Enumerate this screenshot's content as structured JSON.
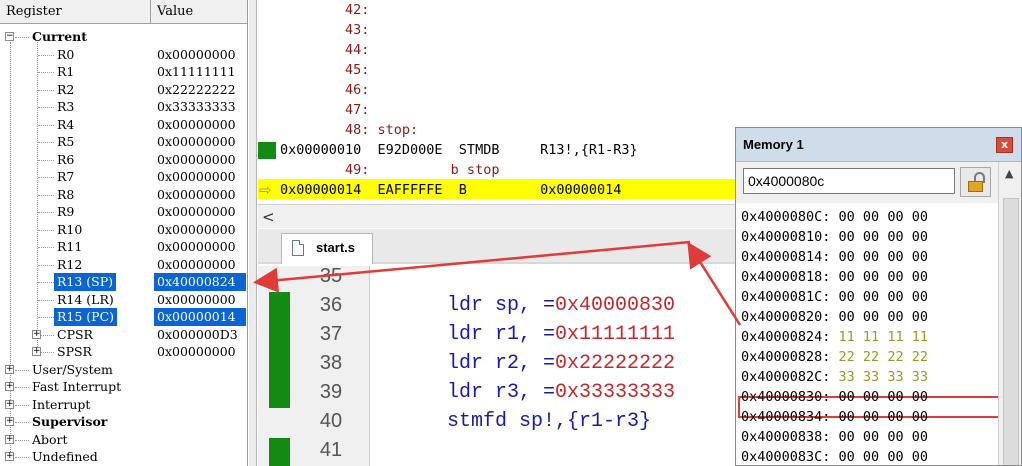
{
  "registers": {
    "header": {
      "register": "Register",
      "value": "Value"
    },
    "current_group": "Current",
    "rows": [
      {
        "name": "R0",
        "value": "0x00000000"
      },
      {
        "name": "R1",
        "value": "0x11111111"
      },
      {
        "name": "R2",
        "value": "0x22222222"
      },
      {
        "name": "R3",
        "value": "0x33333333"
      },
      {
        "name": "R4",
        "value": "0x00000000"
      },
      {
        "name": "R5",
        "value": "0x00000000"
      },
      {
        "name": "R6",
        "value": "0x00000000"
      },
      {
        "name": "R7",
        "value": "0x00000000"
      },
      {
        "name": "R8",
        "value": "0x00000000"
      },
      {
        "name": "R9",
        "value": "0x00000000"
      },
      {
        "name": "R10",
        "value": "0x00000000"
      },
      {
        "name": "R11",
        "value": "0x00000000"
      },
      {
        "name": "R12",
        "value": "0x00000000"
      },
      {
        "name": "R13 (SP)",
        "value": "0x40000824"
      },
      {
        "name": "R14 (LR)",
        "value": "0x00000000"
      },
      {
        "name": "R15 (PC)",
        "value": "0x00000014"
      },
      {
        "name": "CPSR",
        "value": "0x000000D3"
      },
      {
        "name": "SPSR",
        "value": "0x00000000"
      }
    ],
    "modes": [
      "User/System",
      "Fast Interrupt",
      "Interrupt",
      "Supervisor",
      "Abort",
      "Undefined"
    ],
    "selected_rows": [
      "R13 (SP)",
      "R15 (PC)"
    ],
    "selection_color": "#0a64d2"
  },
  "disassembly": {
    "lines": [
      {
        "text": "        42:",
        "kind": "src"
      },
      {
        "text": "        43:",
        "kind": "src"
      },
      {
        "text": "        44:",
        "kind": "src"
      },
      {
        "text": "        45:",
        "kind": "src"
      },
      {
        "text": "        46:",
        "kind": "src"
      },
      {
        "text": "        47:",
        "kind": "src"
      },
      {
        "text": "        48: stop:",
        "kind": "src"
      },
      {
        "text": "0x00000010  E92D000E  STMDB     R13!,{R1-R3}",
        "kind": "asm"
      },
      {
        "text": "        49:          b stop",
        "kind": "src"
      },
      {
        "text": "0x00000014  EAFFFFFE  B         0x00000014",
        "kind": "asm-current"
      }
    ],
    "current_line_color": "#ffff00"
  },
  "editor": {
    "tab_label": "start.s",
    "lines": [
      {
        "num": "35",
        "pre": "",
        "num_part": "",
        "post": ""
      },
      {
        "num": "36",
        "pre": "ldr sp, =",
        "num_part": "0x40000830",
        "post": ""
      },
      {
        "num": "37",
        "pre": "ldr r1, =",
        "num_part": "0x11111111",
        "post": ""
      },
      {
        "num": "38",
        "pre": "ldr r2, =",
        "num_part": "0x22222222",
        "post": ""
      },
      {
        "num": "39",
        "pre": "ldr r3, =",
        "num_part": "0x33333333",
        "post": ""
      },
      {
        "num": "40",
        "pre": "stmfd sp!,{r1-r3}",
        "num_part": "",
        "post": ""
      },
      {
        "num": "41",
        "pre": "",
        "num_part": "",
        "post": ""
      }
    ]
  },
  "memory": {
    "title": "Memory 1",
    "address": "0x4000080c",
    "rows": [
      {
        "addr": "0x4000080C:",
        "bytes": "00 00 00 00",
        "changed": false
      },
      {
        "addr": "0x40000810:",
        "bytes": "00 00 00 00",
        "changed": false
      },
      {
        "addr": "0x40000814:",
        "bytes": "00 00 00 00",
        "changed": false
      },
      {
        "addr": "0x40000818:",
        "bytes": "00 00 00 00",
        "changed": false
      },
      {
        "addr": "0x4000081C:",
        "bytes": "00 00 00 00",
        "changed": false
      },
      {
        "addr": "0x40000820:",
        "bytes": "00 00 00 00",
        "changed": false
      },
      {
        "addr": "0x40000824:",
        "bytes": "11 11 11 11",
        "changed": true
      },
      {
        "addr": "0x40000828:",
        "bytes": "22 22 22 22",
        "changed": true
      },
      {
        "addr": "0x4000082C:",
        "bytes": "33 33 33 33",
        "changed": true
      },
      {
        "addr": "0x40000830:",
        "bytes": "00 00 00 00",
        "changed": false
      },
      {
        "addr": "0x40000834:",
        "bytes": "00 00 00 00",
        "changed": false
      },
      {
        "addr": "0x40000838:",
        "bytes": "00 00 00 00",
        "changed": false
      },
      {
        "addr": "0x4000083C:",
        "bytes": "00 00 00 00",
        "changed": false
      }
    ],
    "highlight_row": "0x40000824:",
    "changed_color": "#9a9a2a",
    "highlight_color": "#e03a3a"
  },
  "annotation_color": "#e03a3a"
}
